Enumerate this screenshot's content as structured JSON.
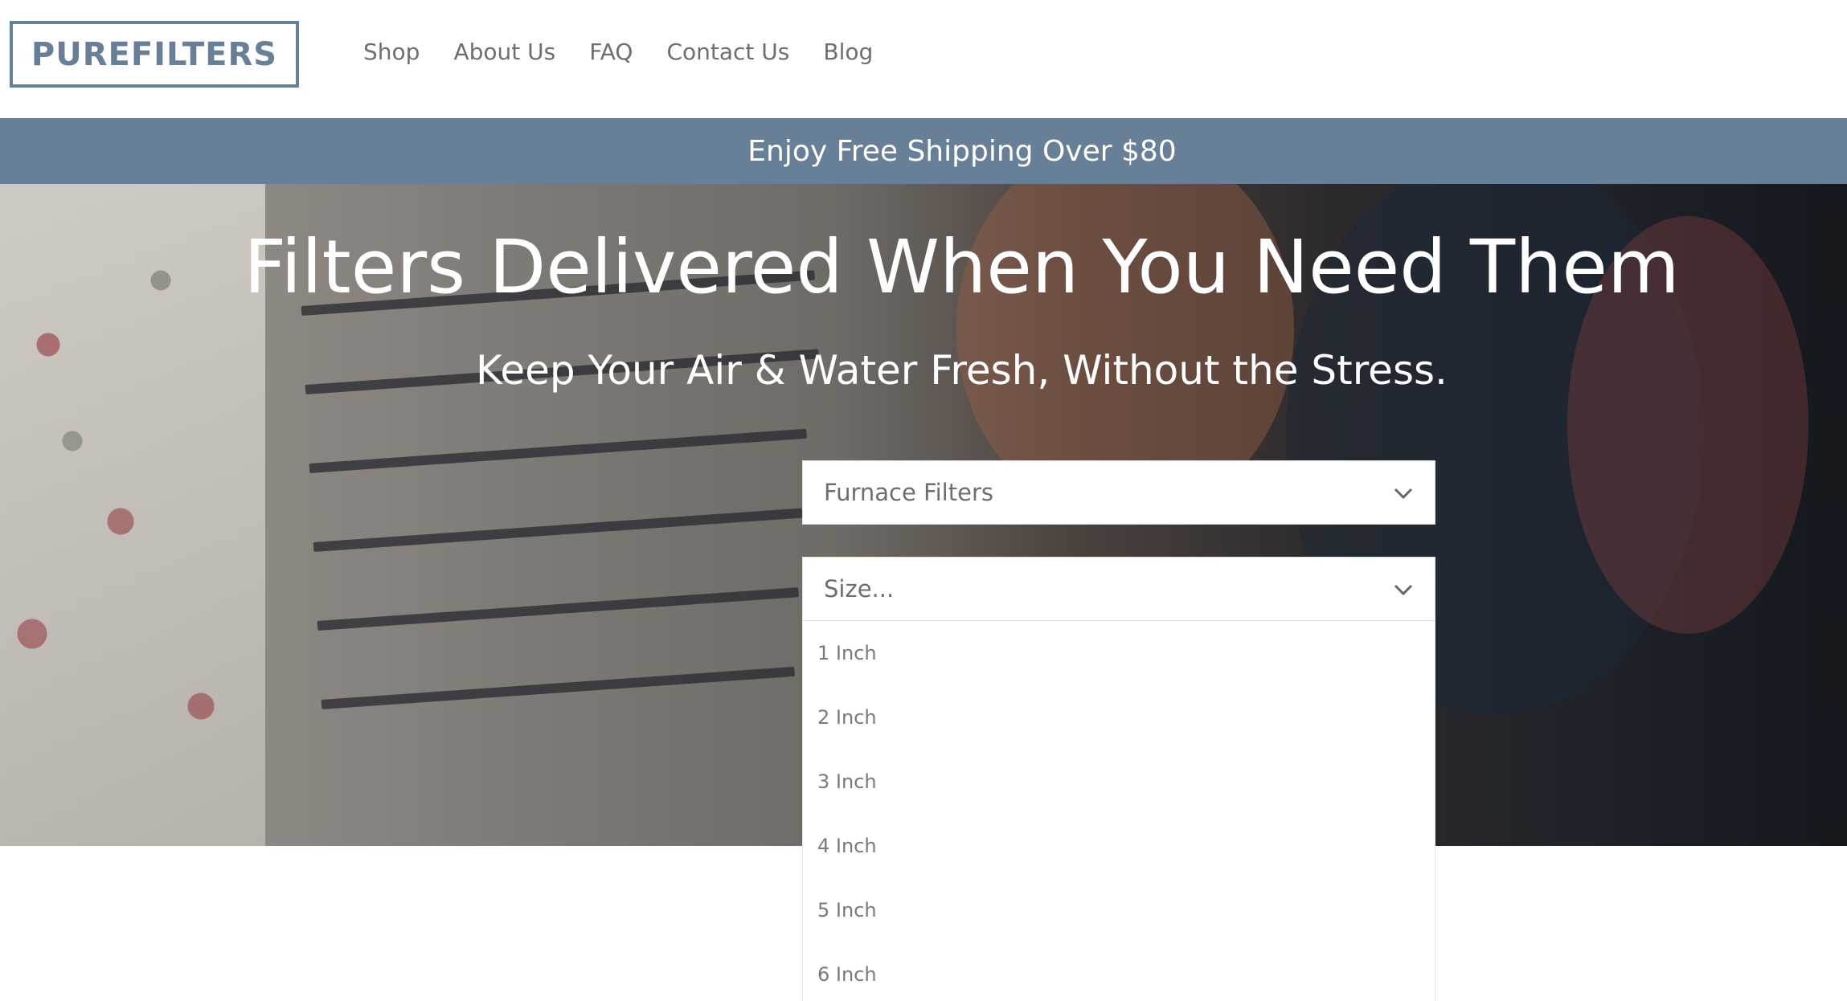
{
  "header": {
    "logo": "PUREFILTERS",
    "nav": [
      "Shop",
      "About Us",
      "FAQ",
      "Contact Us",
      "Blog"
    ]
  },
  "announcement": "Enjoy Free Shipping Over $80",
  "hero": {
    "title": "Filters Delivered When You Need Them",
    "subtitle": "Keep Your Air & Water Fresh, Without the Stress.",
    "filter_type_select": {
      "value": "Furnace Filters"
    },
    "size_select": {
      "placeholder": "Size...",
      "options": [
        "1 Inch",
        "2 Inch",
        "3 Inch",
        "4 Inch",
        "5 Inch",
        "6 Inch"
      ]
    }
  },
  "colors": {
    "brand": "#687f98",
    "nav_text": "#6e6e6e",
    "white": "#ffffff"
  },
  "icons": {
    "select_chevron": "chevron-down-icon"
  }
}
